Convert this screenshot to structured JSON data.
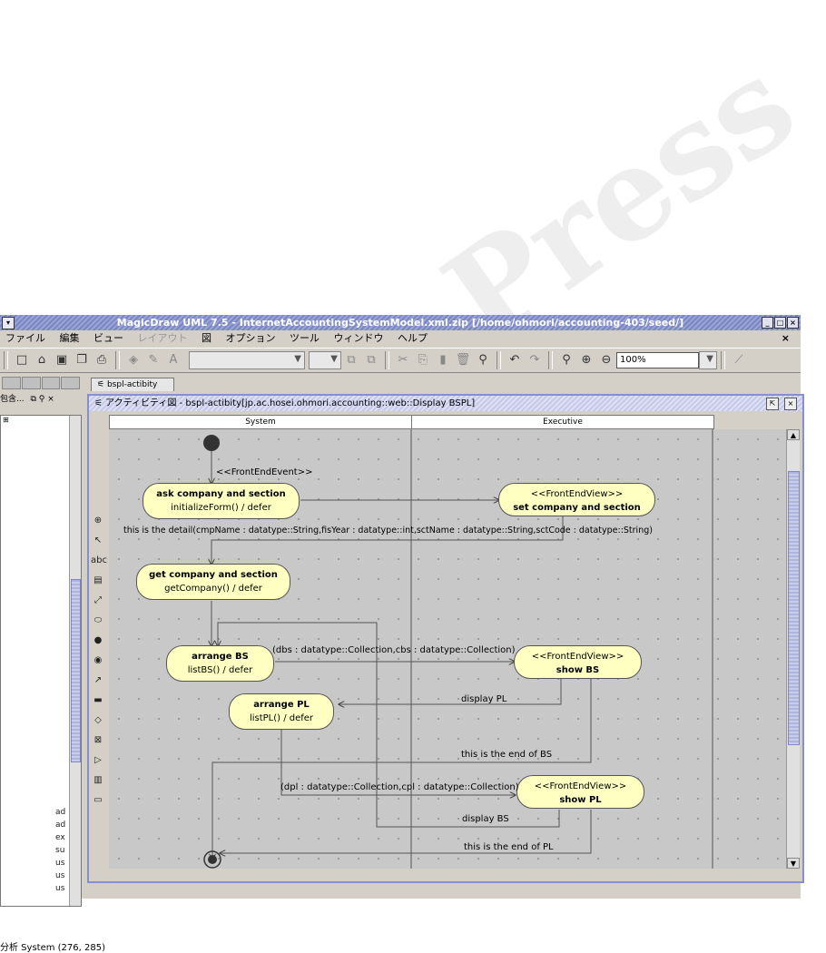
{
  "window": {
    "title": "MagicDraw UML 7.5 - InternetAccountingSystemModel.xml.zip [/home/ohmori/accounting-403/seed/]",
    "menu_close": "×"
  },
  "menu": [
    "ファイル",
    "編集",
    "ビュー",
    "レイアウト",
    "図",
    "オプション",
    "ツール",
    "ウィンドウ",
    "ヘルプ"
  ],
  "menu_disabled": [
    "レイアウト"
  ],
  "toolbar": {
    "zoom": "100%"
  },
  "left_panel": {
    "header": "包含...",
    "status": "分析 System (276, 285)"
  },
  "tree_items": [
    "ad",
    "ad",
    "ex",
    "su",
    "us",
    "us",
    "us"
  ],
  "document_tab": "bspl-actibity",
  "diagram": {
    "title": "アクティビティ図 - bspl-actibity[jp.ac.hosei.ohmori.accounting::web::Display BSPL]",
    "lanes": [
      "System",
      "Executive"
    ],
    "actions": [
      {
        "name": "ask company and section",
        "body": "initializeForm() / defer"
      },
      {
        "stereo": "<<FrontEndView>>",
        "name": "set company and section"
      },
      {
        "name": "get company and section",
        "body": "getCompany() / defer"
      },
      {
        "name": "arrange BS",
        "body": "listBS() / defer"
      },
      {
        "stereo": "<<FrontEndView>>",
        "name": "show BS"
      },
      {
        "name": "arrange PL",
        "body": "listPL() / defer"
      },
      {
        "stereo": "<<FrontEndView>>",
        "name": "show PL"
      }
    ],
    "labels": {
      "event": "<<FrontEndEvent>>",
      "detail": "this is the detail(cmpName : datatype::String,fisYear : datatype::int,sctName : datatype::String,sctCode : datatype::String)",
      "bs_params": "(dbs : datatype::Collection,cbs : datatype::Collection)",
      "display_pl": "display PL",
      "end_bs": "this is the end of BS",
      "pl_params": "(dpl : datatype::Collection,cpl : datatype::Collection)",
      "display_bs": "display BS",
      "end_pl": "this is the end of PL"
    }
  }
}
